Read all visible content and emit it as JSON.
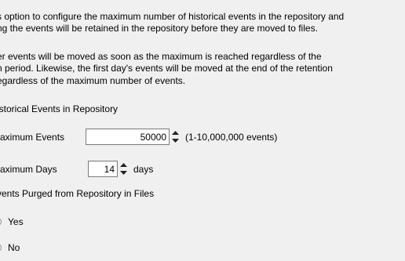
{
  "description": {
    "para1": [
      "s option to configure the maximum number of historical events in the repository and",
      "ng the events will be retained in the repository before they are moved to files."
    ],
    "para2": [
      "er events will be moved as soon as the maximum is reached regardless of the",
      "n period. Likewise, the first day's events will be moved at the end of the retention",
      "egardless of the maximum number of events."
    ]
  },
  "repository": {
    "title": "istorical Events in Repository",
    "max_events": {
      "label": "aximum Events",
      "value": "50000",
      "range": "(1-10,000,000 events)"
    },
    "max_days": {
      "label": "aximum Days",
      "value": "14",
      "unit": "days"
    }
  },
  "purge": {
    "title": "vents Purged from Repository in Files",
    "options": [
      {
        "label": "Yes"
      },
      {
        "label": "No"
      }
    ]
  }
}
